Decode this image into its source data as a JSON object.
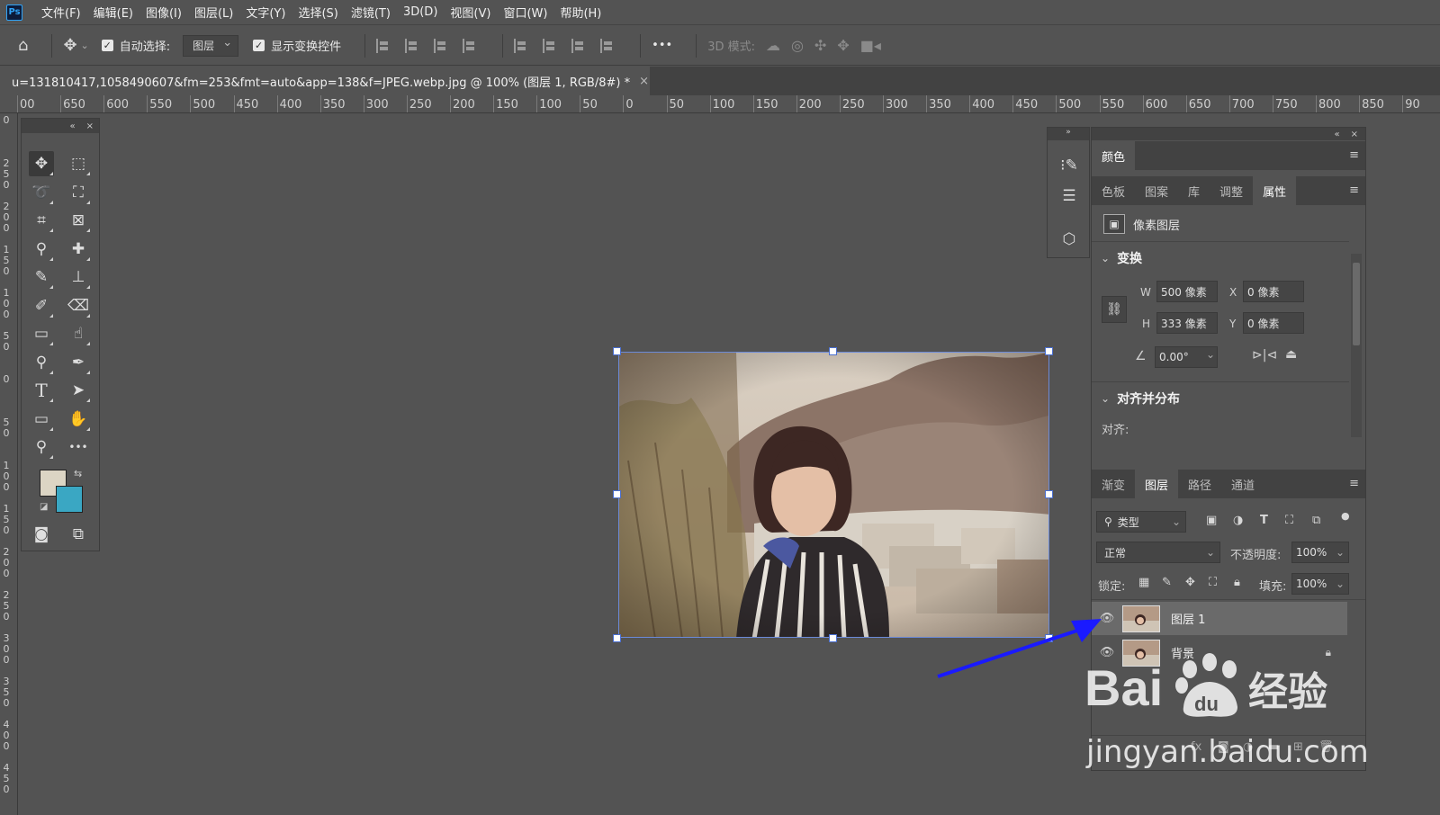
{
  "app": {
    "logo": "Ps"
  },
  "menu": [
    "文件(F)",
    "编辑(E)",
    "图像(I)",
    "图层(L)",
    "文字(Y)",
    "选择(S)",
    "滤镜(T)",
    "3D(D)",
    "视图(V)",
    "窗口(W)",
    "帮助(H)"
  ],
  "options_bar": {
    "auto_select_label": "自动选择:",
    "auto_select_value": "图层",
    "show_transform_label": "显示变换控件",
    "more_label": "•••",
    "mode_3d_label": "3D 模式:"
  },
  "document": {
    "tab_title": "u=131810417,1058490607&fm=253&fmt=auto&app=138&f=JPEG.webp.jpg @ 100% (图层 1, RGB/8#) *",
    "close": "×"
  },
  "ruler_top": [
    "00",
    "650",
    "600",
    "550",
    "500",
    "450",
    "400",
    "350",
    "300",
    "250",
    "200",
    "150",
    "100",
    "50",
    "0",
    "50",
    "100",
    "150",
    "200",
    "250",
    "300",
    "350",
    "400",
    "450",
    "500",
    "550",
    "600",
    "650",
    "700",
    "750",
    "800",
    "850",
    "90"
  ],
  "ruler_left": [
    "0",
    "2 5 0",
    "2 0 0",
    "1 5 0",
    "1 0 0",
    "5 0",
    "0",
    "5 0",
    "1 0 0",
    "1 5 0",
    "2 0 0",
    "2 5 0",
    "3 0 0",
    "3 5 0",
    "4 0 0",
    "4 5 0"
  ],
  "toolbox": {
    "head": {
      "collapse": "«",
      "close": "×"
    },
    "tools": [
      {
        "name": "move-tool-icon",
        "glyph": "✥"
      },
      {
        "name": "marquee-tool-icon",
        "glyph": "⬚"
      },
      {
        "name": "lasso-tool-icon",
        "glyph": "➰"
      },
      {
        "name": "object-select-tool-icon",
        "glyph": "⛶"
      },
      {
        "name": "crop-tool-icon",
        "glyph": "⌗"
      },
      {
        "name": "frame-tool-icon",
        "glyph": "⊠"
      },
      {
        "name": "eyedropper-tool-icon",
        "glyph": "⚲"
      },
      {
        "name": "healing-tool-icon",
        "glyph": "✚"
      },
      {
        "name": "brush-tool-icon",
        "glyph": "✎"
      },
      {
        "name": "stamp-tool-icon",
        "glyph": "⊥"
      },
      {
        "name": "history-brush-tool-icon",
        "glyph": "✐"
      },
      {
        "name": "eraser-tool-icon",
        "glyph": "⌫"
      },
      {
        "name": "gradient-tool-icon",
        "glyph": "▭"
      },
      {
        "name": "smudge-tool-icon",
        "glyph": "☝"
      },
      {
        "name": "dodge-tool-icon",
        "glyph": "⚲"
      },
      {
        "name": "pen-tool-icon",
        "glyph": "✒"
      },
      {
        "name": "type-tool-icon",
        "glyph": "T"
      },
      {
        "name": "path-select-tool-icon",
        "glyph": "➤"
      },
      {
        "name": "rectangle-tool-icon",
        "glyph": "▭"
      },
      {
        "name": "hand-tool-icon",
        "glyph": "✋"
      },
      {
        "name": "zoom-tool-icon",
        "glyph": "⚲"
      },
      {
        "name": "more-tools-icon",
        "glyph": "•••"
      },
      {
        "name": "quick-mask-icon",
        "glyph": "◙"
      },
      {
        "name": "screen-mode-icon",
        "glyph": "⧉"
      }
    ],
    "fg_color": "#dcd5c4",
    "bg_color": "#3aa7c3"
  },
  "panels": {
    "dock_head": {
      "collapse": "«",
      "close": "×"
    },
    "color_tab": "颜色",
    "props_tabs": [
      "色板",
      "图案",
      "库",
      "调整",
      "属性"
    ],
    "props_active": "属性",
    "pixel_layer_label": "像素图层",
    "transform_title": "变换",
    "w_label": "W",
    "w_value": "500 像素",
    "x_label": "X",
    "x_value": "0 像素",
    "h_label": "H",
    "h_value": "333 像素",
    "y_label": "Y",
    "y_value": "0 像素",
    "angle_value": "0.00°",
    "align_title": "对齐并分布",
    "align_label": "对齐:",
    "layers_tabs": [
      "渐变",
      "图层",
      "路径",
      "通道"
    ],
    "layers_active": "图层",
    "filter_kind": "类型",
    "blend_mode": "正常",
    "opacity_label": "不透明度:",
    "opacity_value": "100%",
    "lock_label": "锁定:",
    "fill_label": "填充:",
    "fill_value": "100%",
    "layers": [
      {
        "name": "图层 1",
        "selected": true,
        "locked": false
      },
      {
        "name": "背景",
        "selected": false,
        "locked": true
      }
    ]
  },
  "watermark": {
    "brand": "Bai du 经验",
    "url": "jingyan.baidu.com"
  },
  "colors": {
    "ui_bg": "#535353",
    "panel_dark": "#424242",
    "arrow": "#1a1aff",
    "selection": "#4a6fd0"
  }
}
